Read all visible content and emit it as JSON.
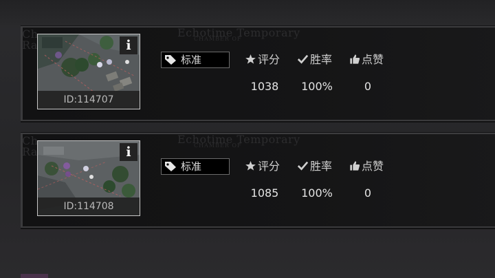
{
  "watermark": {
    "line_title": "Echotime Temporary",
    "line_sub": "CHAMBER OF",
    "frag_left_1": "Ch",
    "frag_left_2": "Ra"
  },
  "stat_headers": {
    "score": "评分",
    "win_rate": "胜率",
    "likes": "点赞"
  },
  "icons": {
    "score": "star-icon",
    "win_rate": "check-icon",
    "likes": "thumbs-up-icon",
    "tag": "tag-icon",
    "info": "info-icon"
  },
  "entries": [
    {
      "id_label": "ID:114707",
      "info_glyph": "i",
      "tag": "标准",
      "score": "1038",
      "win_rate": "100%",
      "likes": "0"
    },
    {
      "id_label": "ID:114708",
      "info_glyph": "i",
      "tag": "标准",
      "score": "1085",
      "win_rate": "100%",
      "likes": "0"
    }
  ]
}
